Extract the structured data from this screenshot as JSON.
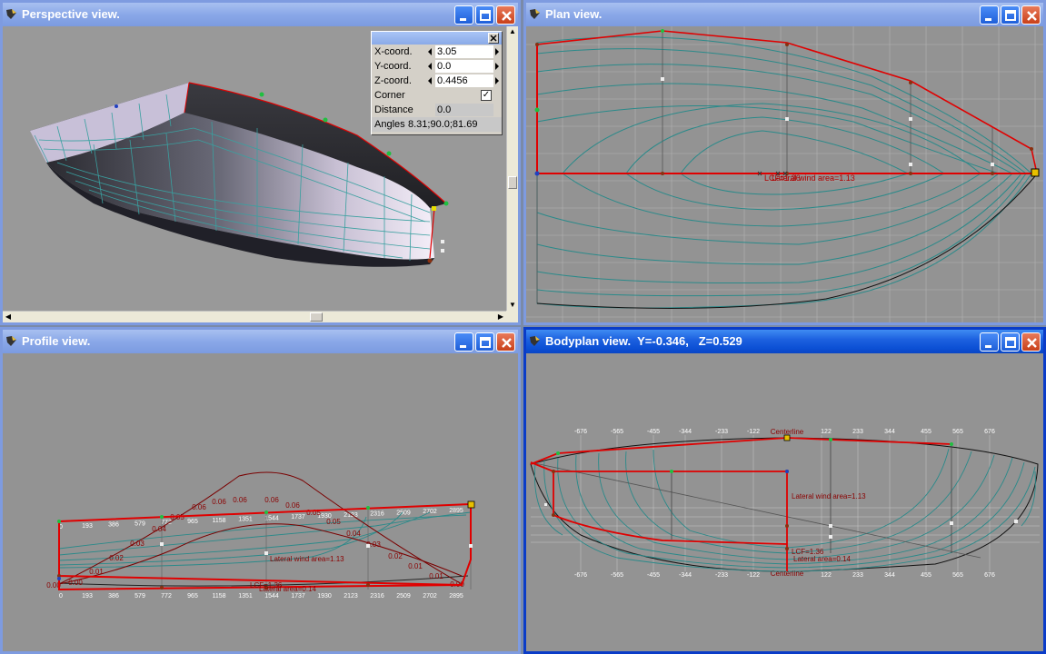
{
  "colors": {
    "hull_line": "#3aa0a0",
    "red_line": "#e00000",
    "titlebar_active": "#0a46c4",
    "viewport_bg": "#939393"
  },
  "perspective": {
    "title": "Perspective view.",
    "icon": "app-icon",
    "coords": {
      "x_label": "X-coord.",
      "x_value": "3.05",
      "y_label": "Y-coord.",
      "y_value": "0.0",
      "z_label": "Z-coord.",
      "z_value": "0.4456",
      "corner_label": "Corner",
      "corner_checked": "✓",
      "distance_label": "Distance",
      "distance_value": "0.0",
      "angles_label": "Angles",
      "angles_value": "8.31;90.0;81.69"
    }
  },
  "plan": {
    "title": "Plan view.",
    "lcf_label": "LCF=1.36",
    "area_label": "Lateral wind area=1.13"
  },
  "profile": {
    "title": "Profile view.",
    "lateral_label": "Lateral wind area=1.13",
    "lcf_label": "LCF=1.36",
    "lateral_area_label": "Lateral area=0.14",
    "curve_values": [
      "0.00",
      "0.00",
      "0.01",
      "0.02",
      "0.03",
      "0.04",
      "0.05",
      "0.06",
      "0.06",
      "0.06",
      "0.06",
      "0.06",
      "0.05",
      "0.05",
      "0.04",
      "0.03",
      "0.02",
      "0.01",
      "0.01",
      "0.00"
    ],
    "ticks": [
      "0",
      "193",
      "386",
      "579",
      "772",
      "965",
      "1158",
      "1351",
      "1544",
      "1737",
      "1930",
      "2123",
      "2316",
      "2509",
      "2702",
      "2895"
    ]
  },
  "bodyplan": {
    "title": "Bodyplan view.  Y=-0.346,   Z=0.529",
    "ticks_top": [
      "-676",
      "-565",
      "-455",
      "-344",
      "-233",
      "-122",
      "Centerline",
      "122",
      "233",
      "344",
      "455",
      "565",
      "676"
    ],
    "ticks_bottom": [
      "-676",
      "-565",
      "-455",
      "-344",
      "-233",
      "-122",
      "Centerline",
      "122",
      "233",
      "344",
      "455",
      "565",
      "676"
    ],
    "lateral_label": "Lateral wind area=1.13",
    "lcf_label": "LCF=1.36",
    "lateral_area_label": "Lateral area=0.14"
  }
}
